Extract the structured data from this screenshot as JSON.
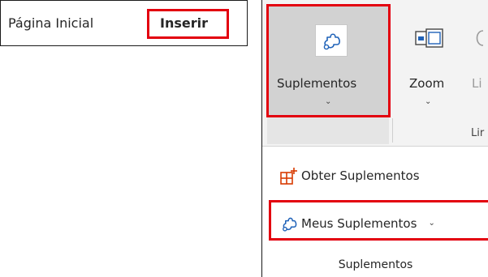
{
  "tabs": {
    "home": "Página Inicial",
    "insert": "Inserir"
  },
  "ribbon": {
    "addins_label": "Suplementos",
    "zoom_label": "Zoom",
    "links_label_partial": "Li",
    "links_group_partial": "Lir",
    "chevron": "⌄"
  },
  "menu": {
    "get_addins": "Obter Suplementos",
    "my_addins": "Meus Suplementos",
    "footer": "Suplementos"
  },
  "colors": {
    "highlight": "#e3000f",
    "icon_blue": "#1f62b8",
    "icon_orange": "#d83b01",
    "selected_bg": "#d2d2d2"
  },
  "icons": [
    "addins-icon",
    "zoom-icon",
    "links-icon",
    "store-icon",
    "my-addins-icon",
    "chevron-down-icon"
  ]
}
